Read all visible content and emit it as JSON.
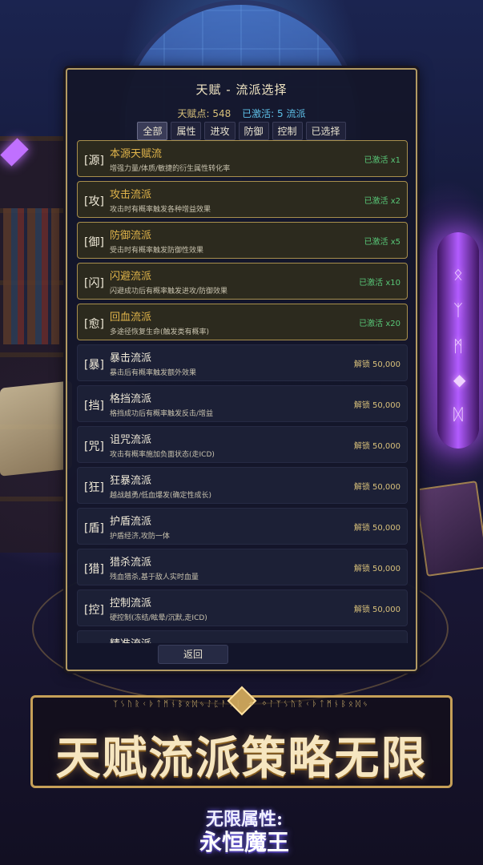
{
  "panel": {
    "title": "天赋 - 流派选择",
    "talent_points_label": "天赋点: 548",
    "activated_label": "已激活: 5 流派",
    "tabs": [
      {
        "label": "全部",
        "active": true
      },
      {
        "label": "属性",
        "active": false
      },
      {
        "label": "进攻",
        "active": false
      },
      {
        "label": "防御",
        "active": false
      },
      {
        "label": "控制",
        "active": false
      },
      {
        "label": "已选择",
        "active": false
      }
    ],
    "items": [
      {
        "glyph": "[源]",
        "name": "本源天赋流",
        "desc": "增强力量/体质/敏捷的衍生属性转化率",
        "status": "已激活 x1",
        "activated": true
      },
      {
        "glyph": "[攻]",
        "name": "攻击流派",
        "desc": "攻击时有概率触发各种增益效果",
        "status": "已激活 x2",
        "activated": true
      },
      {
        "glyph": "[御]",
        "name": "防御流派",
        "desc": "受击时有概率触发防御性效果",
        "status": "已激活 x5",
        "activated": true
      },
      {
        "glyph": "[闪]",
        "name": "闪避流派",
        "desc": "闪避成功后有概率触发进攻/防御效果",
        "status": "已激活 x10",
        "activated": true
      },
      {
        "glyph": "[愈]",
        "name": "回血流派",
        "desc": "多途径恢复生命(触发类有概率)",
        "status": "已激活 x20",
        "activated": true
      },
      {
        "glyph": "[暴]",
        "name": "暴击流派",
        "desc": "暴击后有概率触发额外效果",
        "status": "解锁 50,000",
        "activated": false
      },
      {
        "glyph": "[挡]",
        "name": "格挡流派",
        "desc": "格挡成功后有概率触发反击/增益",
        "status": "解锁 50,000",
        "activated": false
      },
      {
        "glyph": "[咒]",
        "name": "诅咒流派",
        "desc": "攻击有概率施加负面状态(走ICD)",
        "status": "解锁 50,000",
        "activated": false
      },
      {
        "glyph": "[狂]",
        "name": "狂暴流派",
        "desc": "越战越勇/低血爆发(确定性成长)",
        "status": "解锁 50,000",
        "activated": false
      },
      {
        "glyph": "[盾]",
        "name": "护盾流派",
        "desc": "护盾经济,攻防一体",
        "status": "解锁 50,000",
        "activated": false
      },
      {
        "glyph": "[猎]",
        "name": "猎杀流派",
        "desc": "残血猎杀,基于敌人实时血量",
        "status": "解锁 50,000",
        "activated": false
      },
      {
        "glyph": "[控]",
        "name": "控制流派",
        "desc": "硬控制(冻结/眩晕/沉默,走ICD)",
        "status": "解锁 50,000",
        "activated": false
      },
      {
        "glyph": "[精]",
        "name": "精准流派",
        "desc": "",
        "status": "",
        "activated": false
      }
    ],
    "back_label": "返回"
  },
  "banner": {
    "runes": "ᛉᛊᚢᚱᚲᚦᛏᛗᚾᛒᛟᛞᛃᛇᛈᚨᛊᛁ ✦ ᛜᛚᛉᛊᚢᚱᚲᚦᛏᛗᚾᛒᛟᛞᛃ",
    "slogan": "天赋流派策略无限",
    "logo_line1": "无限属性:",
    "logo_line2": "永恒魔王"
  },
  "colors": {
    "gold_border": "#b29a63",
    "activated_green": "#58c878",
    "highlight_gold": "#e0b44a",
    "active_blue": "#5ec0e8"
  }
}
